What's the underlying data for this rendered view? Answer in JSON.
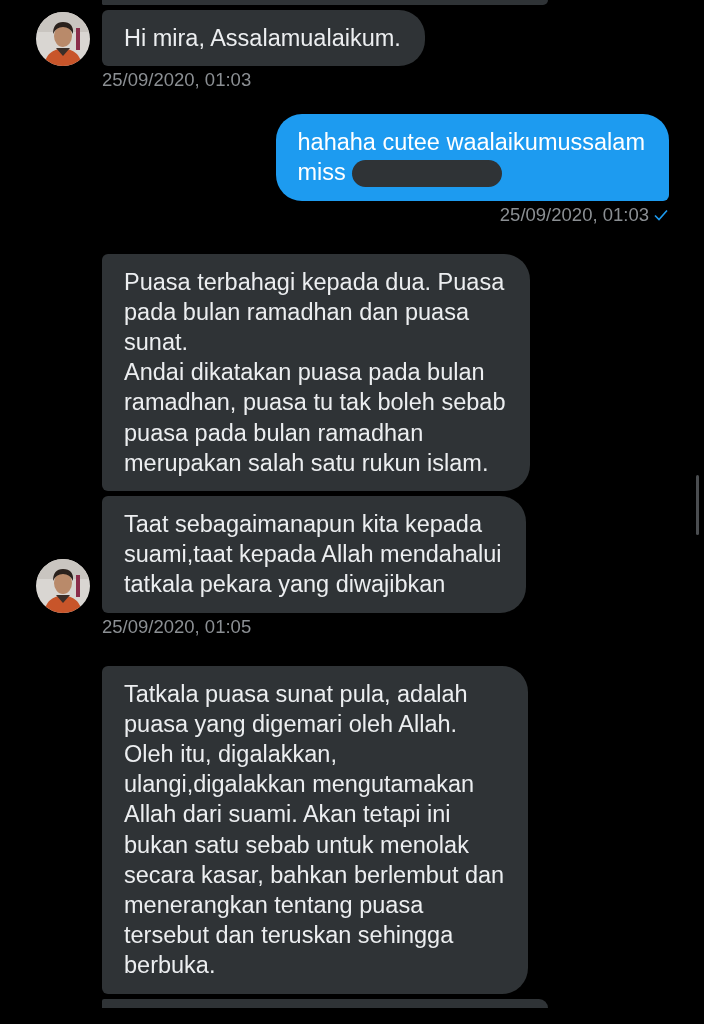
{
  "messages": [
    {
      "kind": "in",
      "partial": true
    },
    {
      "kind": "in",
      "text": "Hi mira, Assalamualaikum.",
      "avatar": true
    },
    {
      "kind": "time_in",
      "text": "25/09/2020, 01:03"
    },
    {
      "kind": "out",
      "text": "hahaha cutee waalaikumussalam\nmiss ",
      "redacted": true
    },
    {
      "kind": "time_out",
      "text": "25/09/2020, 01:03",
      "read": true
    },
    {
      "kind": "in",
      "text": "Puasa terbahagi kepada dua. Puasa\npada bulan ramadhan dan puasa\nsunat.\nAndai dikatakan puasa pada bulan\nramadhan, puasa tu tak boleh sebab\npuasa pada bulan ramadhan\nmerupakan salah satu rukun islam."
    },
    {
      "kind": "in",
      "text": "Taat sebagaimanapun kita kepada\nsuami,taat kepada Allah mendahalui\ntatkala pekara yang diwajibkan",
      "avatar": true
    },
    {
      "kind": "time_in",
      "text": "25/09/2020, 01:05"
    },
    {
      "kind": "in",
      "text": "Tatkala puasa sunat pula, adalah\npuasa yang digemari oleh Allah.\nOleh itu, digalakkan,\nulangi,digalakkan mengutamakan\nAllah dari suami. Akan tetapi ini\nbukan satu sebab untuk menolak\nsecara kasar, bahkan berlembut dan\nmenerangkan tentang puasa\ntersebut dan teruskan sehingga\nberbuka."
    },
    {
      "kind": "in",
      "partial": true
    }
  ]
}
